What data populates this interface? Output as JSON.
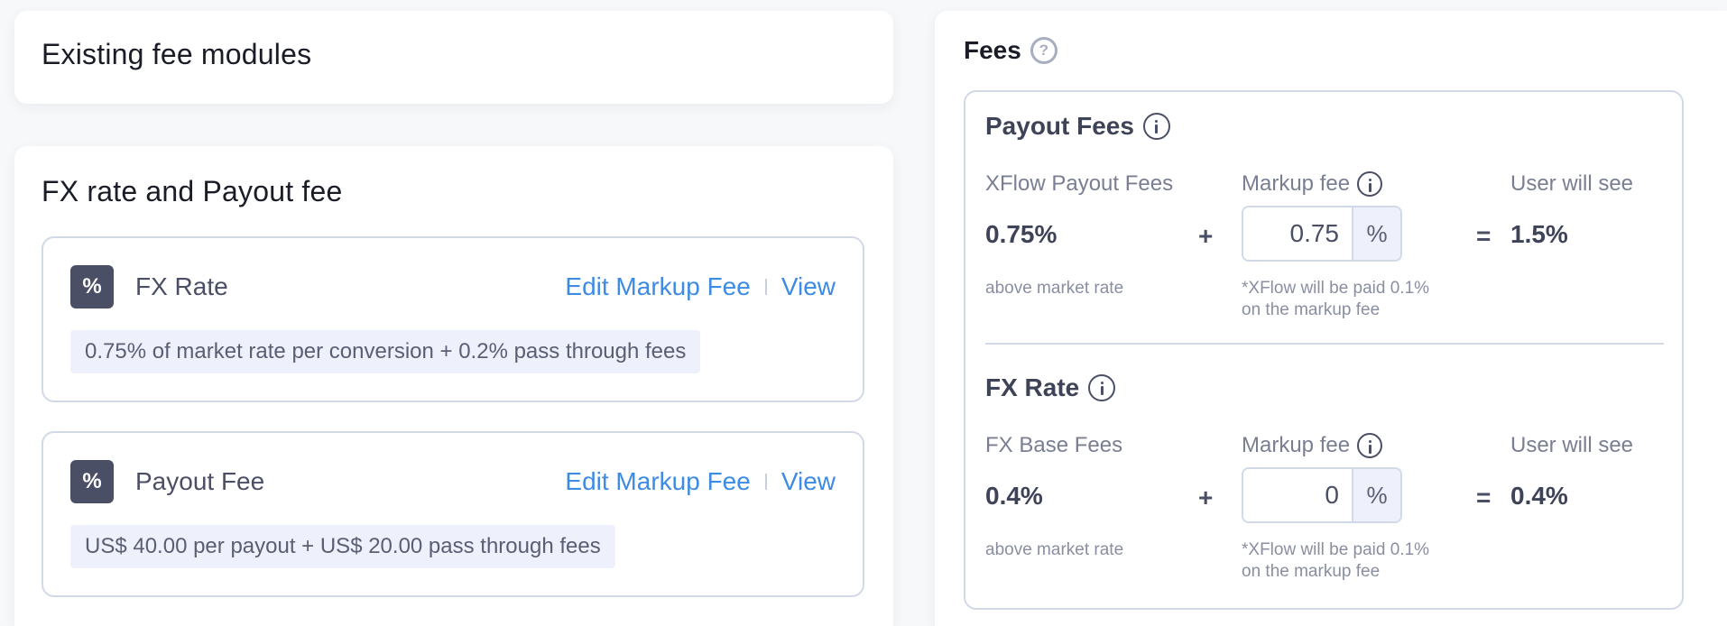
{
  "existing": {
    "title": "Existing fee modules"
  },
  "fx_payout": {
    "title": "FX rate and Payout fee",
    "modules": [
      {
        "badge": "%",
        "name": "FX Rate",
        "edit_label": "Edit Markup Fee",
        "view_label": "View",
        "summary": "0.75% of market rate per conversion + 0.2% pass through fees"
      },
      {
        "badge": "%",
        "name": "Payout Fee",
        "edit_label": "Edit Markup Fee",
        "view_label": "View",
        "summary": "US$ 40.00 per payout + US$ 20.00 pass through fees"
      }
    ]
  },
  "fees": {
    "title": "Fees",
    "help_glyph": "?",
    "sections": [
      {
        "title": "Payout Fees",
        "base_label": "XFlow Payout Fees",
        "base_value": "0.75%",
        "base_note": "above market rate",
        "plus": "+",
        "markup_label": "Markup fee",
        "markup_value": "0.75",
        "markup_unit": "%",
        "markup_note_1": "*XFlow will be paid 0.1%",
        "markup_note_2": "on the markup fee",
        "equals": "=",
        "result_label": "User will see",
        "result_value": "1.5%"
      },
      {
        "title": "FX Rate",
        "base_label": "FX Base Fees",
        "base_value": "0.4%",
        "base_note": "above market rate",
        "plus": "+",
        "markup_label": "Markup fee",
        "markup_value": "0",
        "markup_unit": "%",
        "markup_note_1": "*XFlow will be paid 0.1%",
        "markup_note_2": "on the markup fee",
        "equals": "=",
        "result_label": "User will see",
        "result_value": "0.4%"
      }
    ]
  },
  "colors": {
    "link": "#3d8be3",
    "badge_bg": "#4a4f66",
    "chip_bg": "#eef0fb",
    "border": "#d2d9e6"
  }
}
